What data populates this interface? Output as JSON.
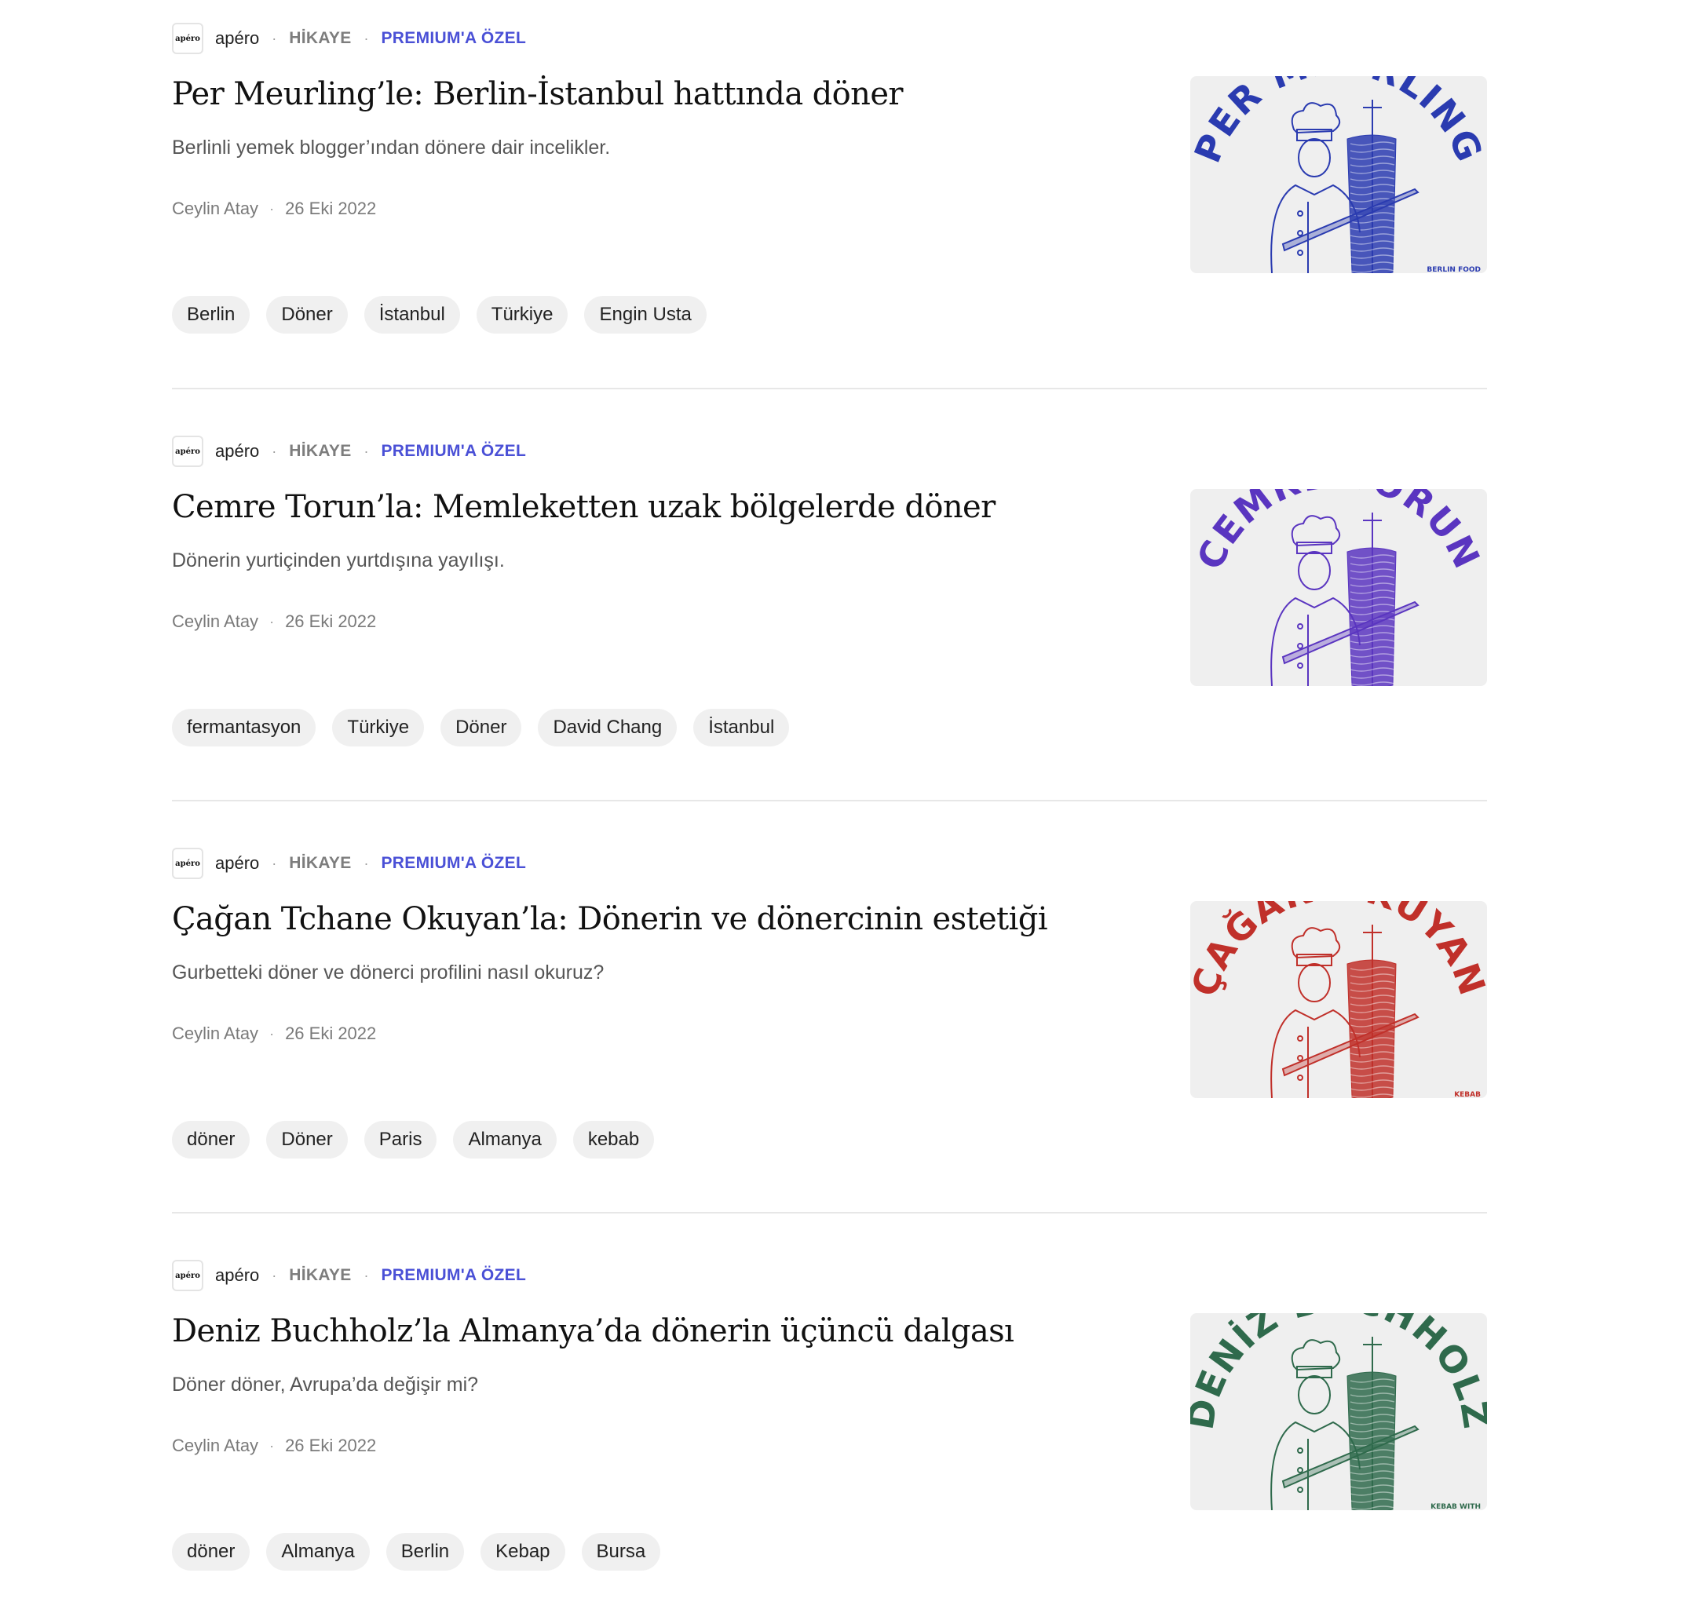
{
  "articles": [
    {
      "publication": "apéro",
      "publication_logo": "apéro",
      "category": "HİKAYE",
      "badge": "PREMIUM'A ÖZEL",
      "title": "Per Meurling’le: Berlin-İstanbul hattında döner",
      "subtitle": "Berlinli yemek blogger’ından dönere dair incelikler.",
      "author": "Ceylin Atay",
      "date": "26 Eki 2022",
      "tags": [
        "Berlin",
        "Döner",
        "İstanbul",
        "Türkiye",
        "Engin Usta"
      ],
      "image": {
        "arc_text": "PER MEURLING",
        "corner_text": "BERLIN FOOD",
        "color": "#2a3bb0"
      }
    },
    {
      "publication": "apéro",
      "publication_logo": "apéro",
      "category": "HİKAYE",
      "badge": "PREMIUM'A ÖZEL",
      "title": "Cemre Torun’la: Memleketten uzak bölgelerde döner",
      "subtitle": "Dönerin yurtiçinden yurtdışına yayılışı.",
      "author": "Ceylin Atay",
      "date": "26 Eki 2022",
      "tags": [
        "fermantasyon",
        "Türkiye",
        "Döner",
        "David Chang",
        "İstanbul"
      ],
      "image": {
        "arc_text": "CEMRE TORUN",
        "corner_text": "",
        "color": "#5a35c0"
      }
    },
    {
      "publication": "apéro",
      "publication_logo": "apéro",
      "category": "HİKAYE",
      "badge": "PREMIUM'A ÖZEL",
      "title": "Çağan Tchane Okuyan’la: Dönerin ve dönercinin estetiği",
      "subtitle": "Gurbetteki döner ve dönerci profilini nasıl okuruz?",
      "author": "Ceylin Atay",
      "date": "26 Eki 2022",
      "tags": [
        "döner",
        "Döner",
        "Paris",
        "Almanya",
        "kebab"
      ],
      "image": {
        "arc_text": "ÇAĞAN OKUYAN",
        "corner_text": "KEBAB",
        "color": "#c0302a"
      }
    },
    {
      "publication": "apéro",
      "publication_logo": "apéro",
      "category": "HİKAYE",
      "badge": "PREMIUM'A ÖZEL",
      "title": "Deniz Buchholz’la Almanya’da dönerin üçüncü dalgası",
      "subtitle": "Döner döner, Avrupa’da değişir mi?",
      "author": "Ceylin Atay",
      "date": "26 Eki 2022",
      "tags": [
        "döner",
        "Almanya",
        "Berlin",
        "Kebap",
        "Bursa"
      ],
      "image": {
        "arc_text": "DENİZ BUCHHOLZ",
        "corner_text": "KEBAB WITH",
        "color": "#2f6a4c"
      }
    }
  ]
}
